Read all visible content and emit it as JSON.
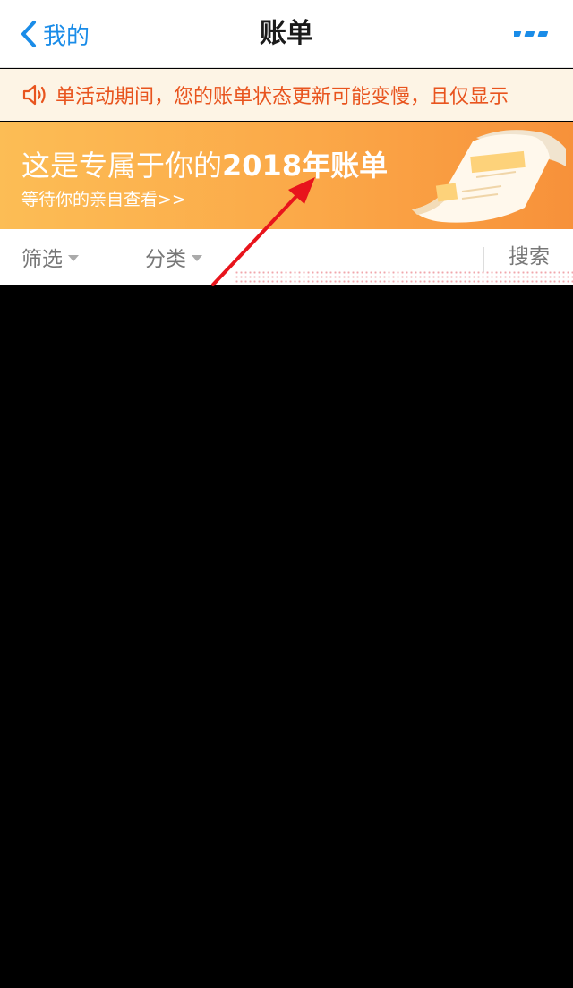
{
  "navbar": {
    "back_label": "我的",
    "title": "账单",
    "more_icon": "more-dots-icon",
    "back_icon": "chevron-left-icon"
  },
  "notice": {
    "icon": "speaker-icon",
    "text": "单活动期间，您的账单状态更新可能变慢，且仅显示"
  },
  "banner": {
    "title_prefix": "这是专属于你的",
    "title_highlight": "2018年账单",
    "subtitle": "等待你的亲自查看>>",
    "illustration": "bill-paper-illustration"
  },
  "filters": {
    "filter_label": "筛选",
    "category_label": "分类",
    "search_label": "搜索"
  },
  "colors": {
    "accent_blue": "#1a8ce8",
    "notice_text": "#e8541e",
    "notice_bg": "#fdf4e5",
    "banner_orange": "#fba848",
    "annotation_arrow": "#e8141c"
  }
}
